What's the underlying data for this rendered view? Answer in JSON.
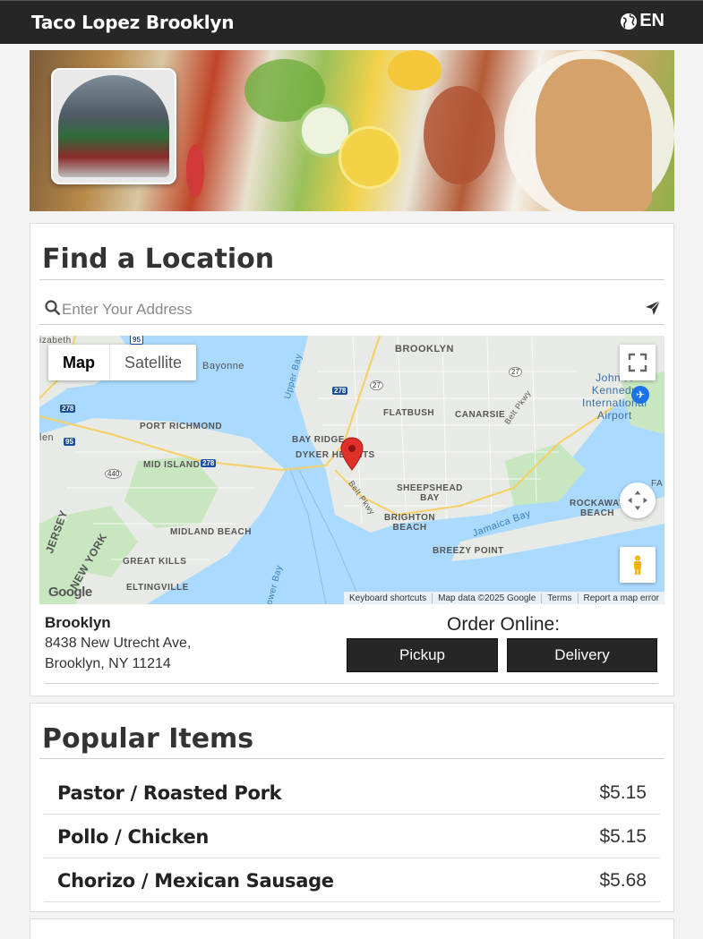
{
  "header": {
    "brand": "Taco Lopez Brooklyn",
    "language": "EN"
  },
  "find_location": {
    "title": "Find a Location",
    "search_placeholder": "Enter Your Address"
  },
  "map": {
    "toggle": [
      "Map",
      "Satellite"
    ],
    "labels": {
      "brooklyn": "BROOKLYN",
      "flatbush": "FLATBUSH",
      "canarsie": "CANARSIE",
      "port_richmond": "PORT RICHMOND",
      "bay_ridge": "BAY RIDGE",
      "dyker_heights": "DYKER HEIGHTS",
      "mid_island": "MID ISLAND",
      "sheepshead_bay": "SHEEPSHEAD\nBAY",
      "brighton_beach": "BRIGHTON\nBEACH",
      "rockaway_beach": "ROCKAWAY\nBEACH",
      "midland_beach": "MIDLAND BEACH",
      "great_kills": "GREAT KILLS",
      "breezy_point": "BREEZY POINT",
      "eltingville": "ELTINGVILLE",
      "new_york": "NEW YORK",
      "jersey": "JERSEY",
      "upper_bay": "Upper Bay",
      "jamaica_bay": "Jamaica Bay",
      "lower_bay": "Lower Bay",
      "belt_pkwy": "Belt Pkwy",
      "belt_pkwy_2": "Belt Pkwy",
      "jfk": "John F.\nKennedy\nInternational\nAirport",
      "elizabeth": "izabeth",
      "bayonne": "Bayonne",
      "elen": "len",
      "fa": "FA"
    },
    "shields": [
      "95",
      "278",
      "27",
      "278",
      "27",
      "278",
      "95",
      "440",
      "278"
    ],
    "logo": "Google",
    "attribution": [
      "Keyboard shortcuts",
      "Map data ©2025 Google",
      "Terms",
      "Report a map error"
    ]
  },
  "location": {
    "name": "Brooklyn",
    "address_line1": "8438 New Utrecht Ave,",
    "address_line2": "Brooklyn, NY 11214",
    "order_label": "Order Online:",
    "pickup": "Pickup",
    "delivery": "Delivery"
  },
  "popular": {
    "title": "Popular Items",
    "items": [
      {
        "name": "Pastor / Roasted Pork",
        "price": "$5.15"
      },
      {
        "name": "Pollo / Chicken",
        "price": "$5.15"
      },
      {
        "name": "Chorizo / Mexican Sausage",
        "price": "$5.68"
      }
    ]
  },
  "colors": {
    "header_bg": "#262626",
    "button_bg": "#262626",
    "water": "#aadaff",
    "land": "#e8eae5",
    "park": "#c8e6c0",
    "pin": "#e0302a"
  }
}
